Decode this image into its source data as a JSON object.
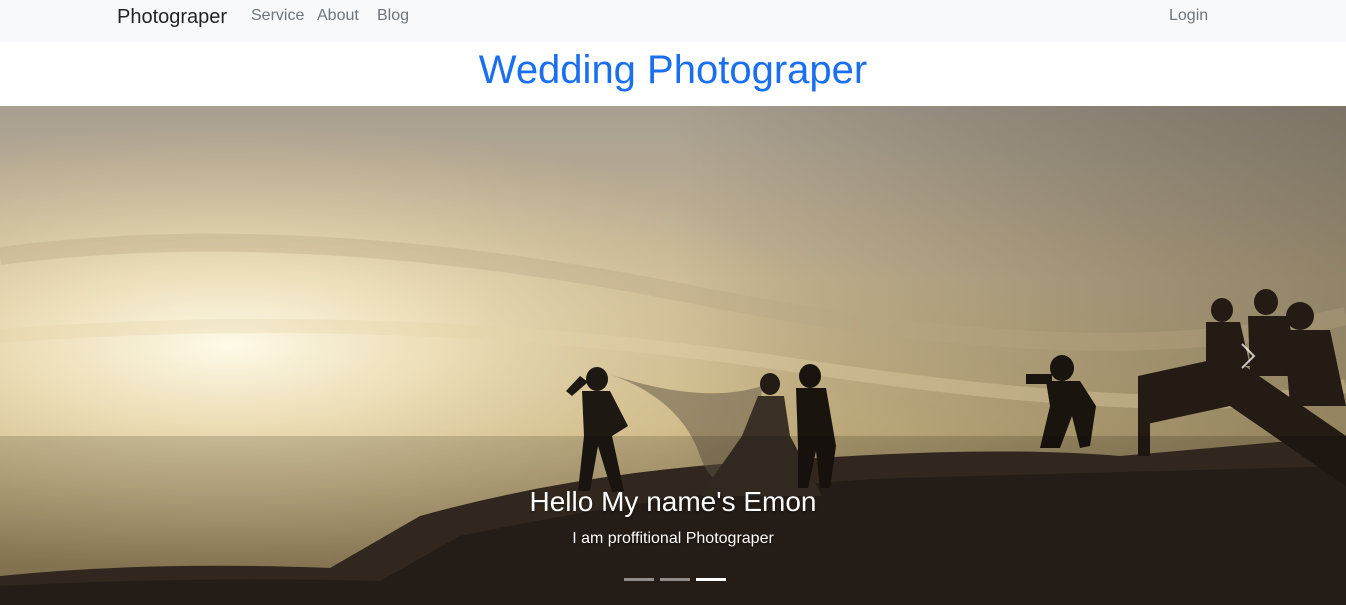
{
  "nav": {
    "brand": "Photograper",
    "links": [
      {
        "label": "Service"
      },
      {
        "label": "About"
      },
      {
        "label": "Blog"
      }
    ],
    "login": "Login"
  },
  "page_title": "Wedding Photograper",
  "carousel": {
    "caption_title": "Hello My name's Emon",
    "caption_text": "I am proffitional Photograper",
    "slide_count": 3,
    "active_slide": 3,
    "next_icon": "chevron-right-icon"
  },
  "colors": {
    "title": "#1a6ff0",
    "navbar_bg": "#f8f9fa",
    "nav_link": "#6c757d"
  }
}
